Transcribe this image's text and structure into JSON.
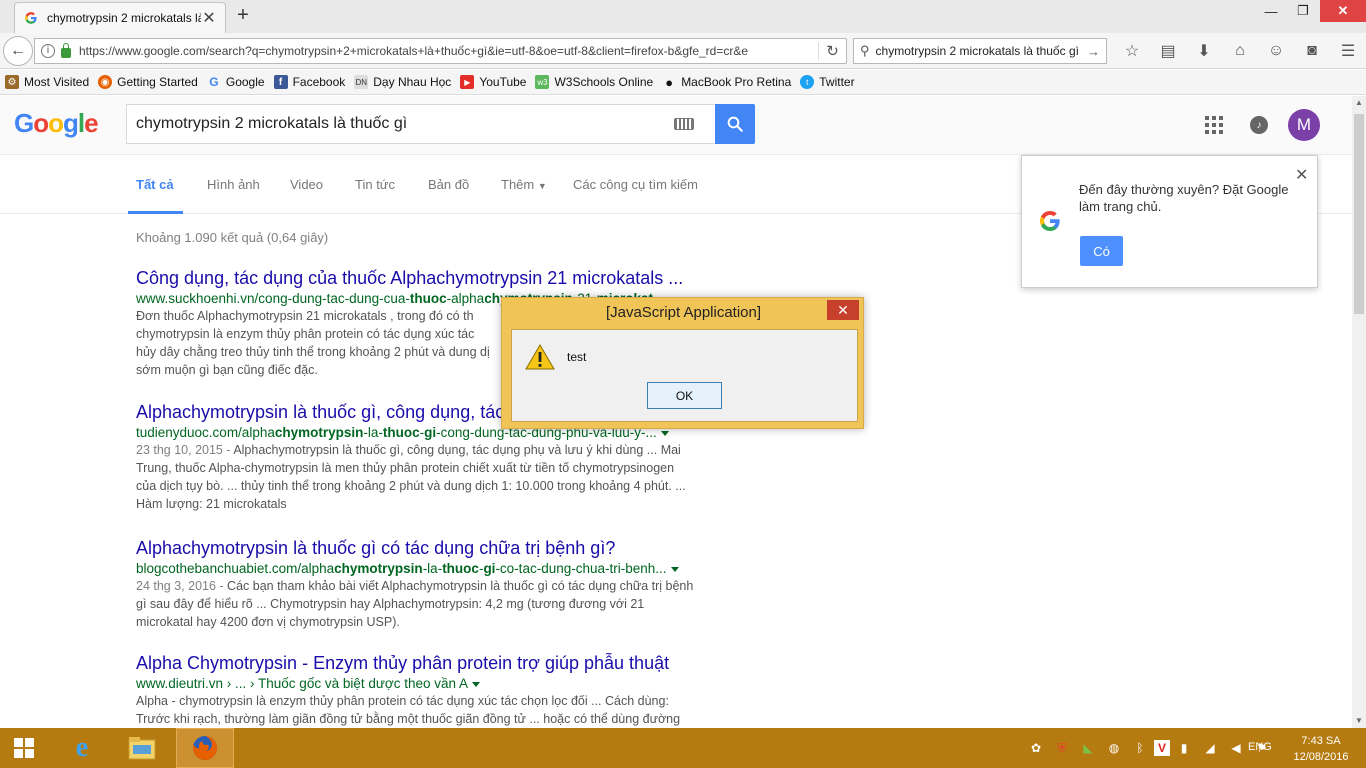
{
  "browser": {
    "tab_title": "chymotrypsin 2 microkatals là thuốc gì",
    "url": "https://www.google.com/search?q=chymotrypsin+2+microkatals+là+thuốc+gì&ie=utf-8&oe=utf-8&client=firefox-b&gfe_rd=cr&e",
    "search_value": "chymotrypsin 2 microkatals là thuốc gì",
    "bookmarks": [
      "Most Visited",
      "Getting Started",
      "Google",
      "Facebook",
      "Dạy Nhau Học",
      "YouTube",
      "W3Schools Online",
      "MacBook Pro Retina",
      "Twitter"
    ]
  },
  "google": {
    "query": "chymotrypsin 2 microkatals là thuốc gì",
    "tabs": [
      "Tất cả",
      "Hình ảnh",
      "Video",
      "Tin tức",
      "Bản đồ",
      "Thêm",
      "Các công cụ tìm kiếm"
    ],
    "avatar_letter": "M",
    "stats": "Khoảng 1.090 kết quả (0,64 giây)",
    "results": [
      {
        "title": "Công dụng, tác dụng của thuốc Alphachymotrypsin 21 microkatals ...",
        "url_a": "www.suckhoenhi.vn/cong-dung-tac-dung-cua-",
        "url_b": "thuoc",
        "url_c": "-alpha",
        "url_d": "chymotrypsin",
        "url_e": "-21-",
        "url_f": "microkat",
        "url_g": "...",
        "snip1": "Đơn thuốc Alphachymotrypsin 21 microkatals , trong đó có th",
        "snip2": "chymotrypsin là enzym thủy phân protein có tác dụng xúc tác",
        "snip3": "hủy dây chằng treo thủy tinh thể trong khoảng 2 phút và dung dị",
        "snip4": "sớm muộn gì bạn cũng điếc đặc."
      },
      {
        "title": "Alphachymotrypsin là thuốc gì, công dụng, tác",
        "url_a": "tudienyduoc.com/alpha",
        "url_b": "chymotrypsin",
        "url_c": "-la-",
        "url_d": "thuoc",
        "url_e": "-",
        "url_f": "gi",
        "url_g": "-cong-dung-tac-dung-phu-va-luu-y-...",
        "date": "23 thg 10, 2015 - ",
        "snip1": "Alphachymotrypsin là thuốc gì, công dụng, tác dụng phụ và lưu ý khi dùng ... Mai",
        "snip2": "Trung, thuốc Alpha-chymotrypsin là men thủy phân protein chiết xuất từ tiền tố chymotrypsinogen",
        "snip3": "của dịch tụy bò. ... thủy tinh thể trong khoảng 2 phút và dung dịch 1: 10.000 trong khoảng 4 phút. ...",
        "snip4": "Hàm lượng: 21 microkatals"
      },
      {
        "title": "Alphachymotrypsin là thuốc gì có tác dụng chữa trị bệnh gì?",
        "url_a": "blogcothebanchuabiet.com/alpha",
        "url_b": "chymotrypsin",
        "url_c": "-la-",
        "url_d": "thuoc",
        "url_e": "-",
        "url_f": "gi",
        "url_g": "-co-tac-dung-chua-tri-benh...",
        "date": "24 thg 3, 2016 - ",
        "snip1": "Các bạn tham khảo bài viết Alphachymotrypsin là thuốc gì có tác dụng chữa trị bệnh",
        "snip2": "gì sau đây để hiểu rõ ... Chymotrypsin hay Alphachymotrypsin: 4,2 mg (tương đương với 21",
        "snip3": "microkatal hay 4200 đơn vị chymotrypsin USP)."
      },
      {
        "title": "Alpha Chymotrypsin - Enzym thủy phân protein trợ giúp phẫu thuật",
        "url_a": "www.dieutri.vn › ... › Thuốc gốc và biệt dược theo vần A",
        "snip1": "Alpha - chymotrypsin là enzym thủy phân protein có tác dụng xúc tác chọn lọc đối ... Cách dùng:",
        "snip2": "Trước khi rạch, thường làm giãn đồng tử bằng một thuốc giãn đồng tử ... hoặc có thể dùng đường"
      }
    ],
    "popup": {
      "text": "Đến đây thường xuyên? Đặt Google làm trang chủ.",
      "button": "Có"
    }
  },
  "alert": {
    "title": "[JavaScript Application]",
    "message": "test",
    "ok": "OK"
  },
  "taskbar": {
    "lang": "ENG",
    "time": "7:43 SA",
    "date": "12/08/2016"
  }
}
